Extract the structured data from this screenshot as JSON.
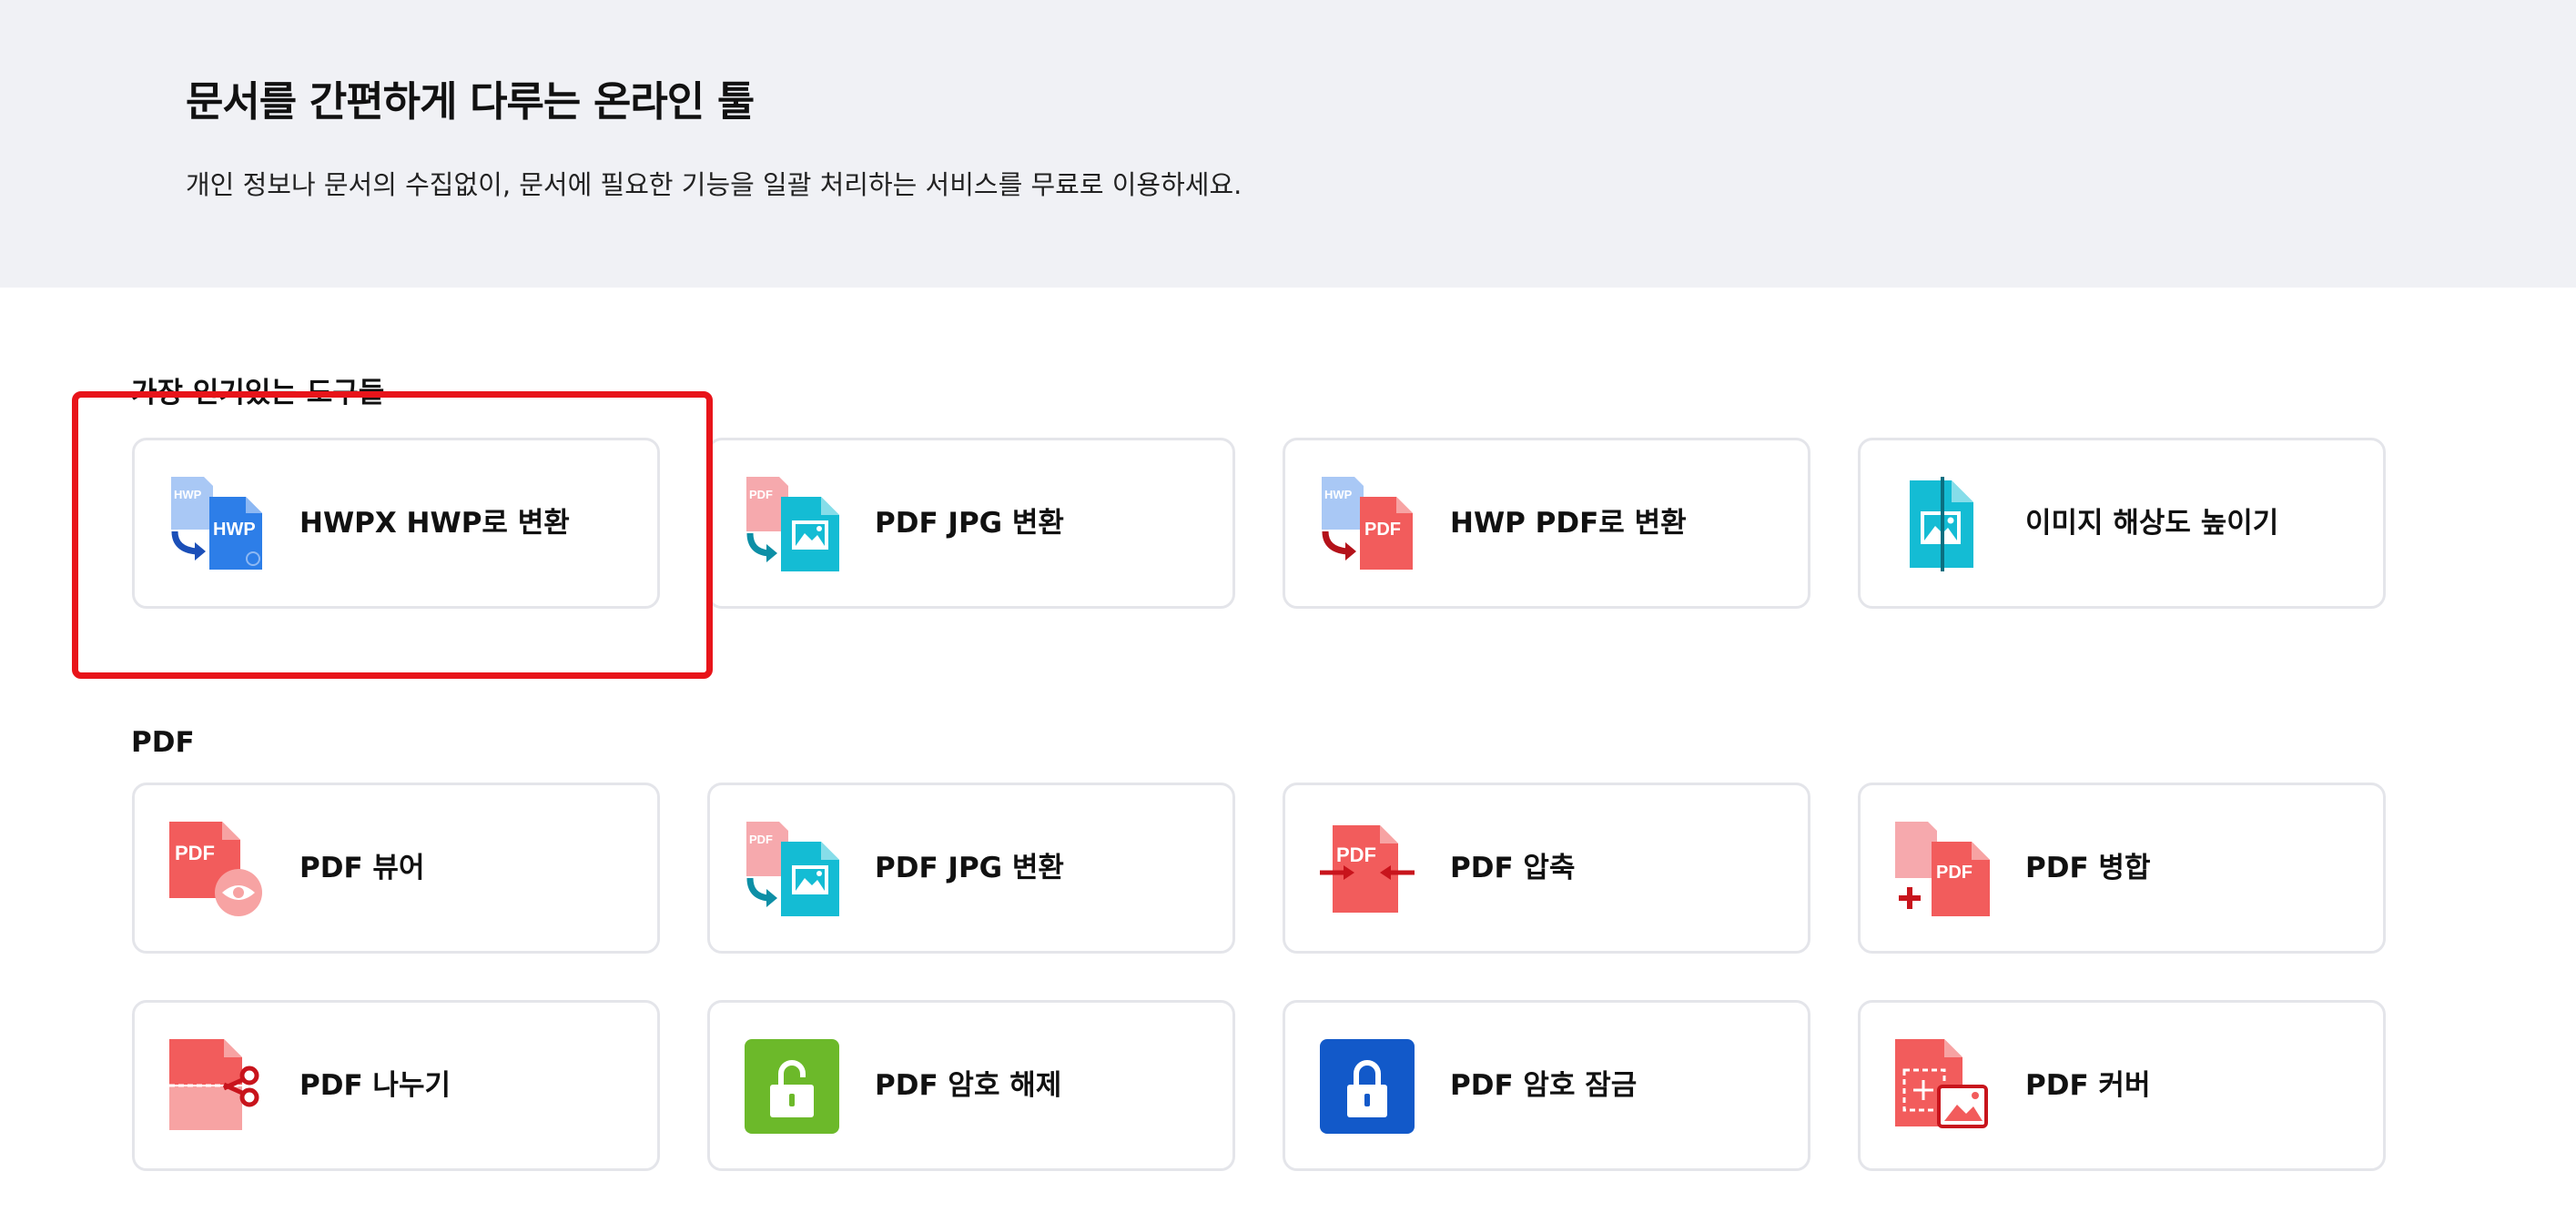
{
  "hero": {
    "title": "문서를 간편하게 다루는 온라인 툴",
    "subtitle": "개인 정보나 문서의 수집없이, 문서에 필요한 기능을 일괄 처리하는 서비스를 무료로 이용하세요."
  },
  "sections": {
    "popular": {
      "title": "가장 인기있는 도구들",
      "items": [
        {
          "label": "HWPX HWP로 변환",
          "icon": "hwpx-to-hwp-icon"
        },
        {
          "label": "PDF JPG 변환",
          "icon": "pdf-to-jpg-icon"
        },
        {
          "label": "HWP PDF로 변환",
          "icon": "hwp-to-pdf-icon"
        },
        {
          "label": "이미지 해상도 높이기",
          "icon": "image-upscale-icon"
        }
      ]
    },
    "pdf": {
      "title": "PDF",
      "items": [
        {
          "label": "PDF 뷰어",
          "icon": "pdf-viewer-icon"
        },
        {
          "label": "PDF JPG 변환",
          "icon": "pdf-to-jpg-icon"
        },
        {
          "label": "PDF 압축",
          "icon": "pdf-compress-icon"
        },
        {
          "label": "PDF 병합",
          "icon": "pdf-merge-icon"
        },
        {
          "label": "PDF 나누기",
          "icon": "pdf-split-icon"
        },
        {
          "label": "PDF 암호 해제",
          "icon": "pdf-unlock-icon"
        },
        {
          "label": "PDF 암호 잠금",
          "icon": "pdf-lock-icon"
        },
        {
          "label": "PDF 커버",
          "icon": "pdf-cover-icon"
        }
      ]
    }
  },
  "icon_text": {
    "hwp": "HWP",
    "pdf": "PDF"
  },
  "colors": {
    "hero_background": "#f0f1f5",
    "card_border": "#e4e5ea",
    "highlight": "#e8141a",
    "hwp_blue": "#2d7ee8",
    "pdf_red": "#f25c5c",
    "image_cyan": "#14bcd4",
    "unlock_green": "#6cb92a",
    "lock_blue": "#1259c9"
  }
}
